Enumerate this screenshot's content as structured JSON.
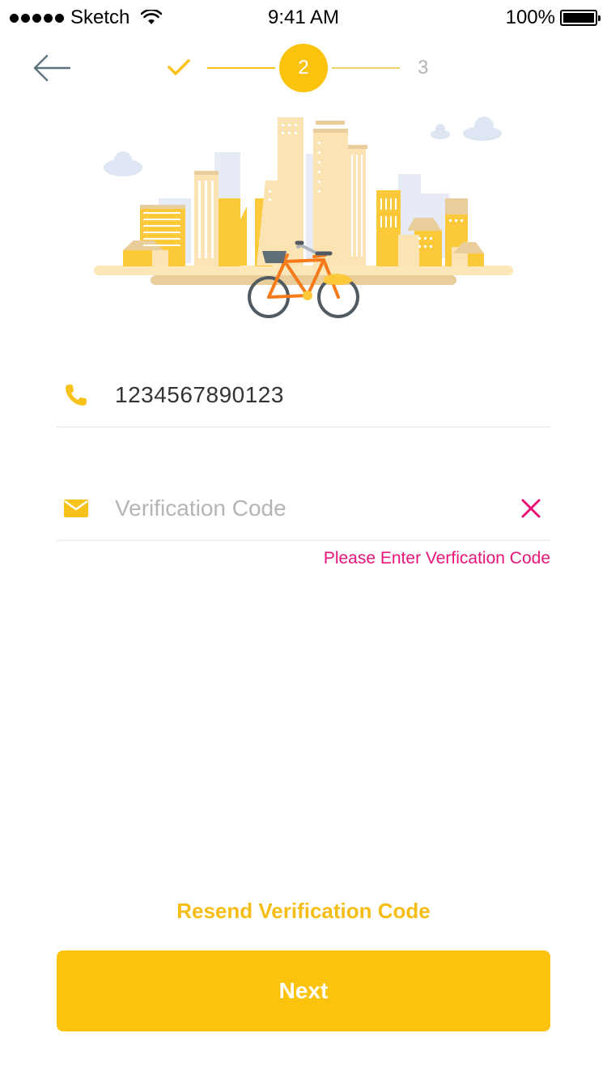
{
  "status_bar": {
    "carrier": "Sketch",
    "time": "9:41 AM",
    "battery": "100%"
  },
  "header": {
    "back_icon": "arrow-left-icon",
    "steps": [
      {
        "label": "",
        "state": "done",
        "icon": "checkmark-icon"
      },
      {
        "label": "2",
        "state": "current"
      },
      {
        "label": "3",
        "state": "upcoming"
      }
    ]
  },
  "illustration": {
    "icon": "city-bicycle-illustration"
  },
  "form": {
    "phone": {
      "icon": "phone-icon",
      "value": "1234567890123"
    },
    "code": {
      "icon": "envelope-icon",
      "placeholder": "Verification Code",
      "value": "",
      "clear_icon": "close-icon",
      "error": "Please Enter Verfication Code"
    }
  },
  "actions": {
    "resend": "Resend Verification Code",
    "next": "Next"
  },
  "colors": {
    "accent": "#FBC30C",
    "error": "#E8147A",
    "placeholder": "#B5B5B5"
  }
}
